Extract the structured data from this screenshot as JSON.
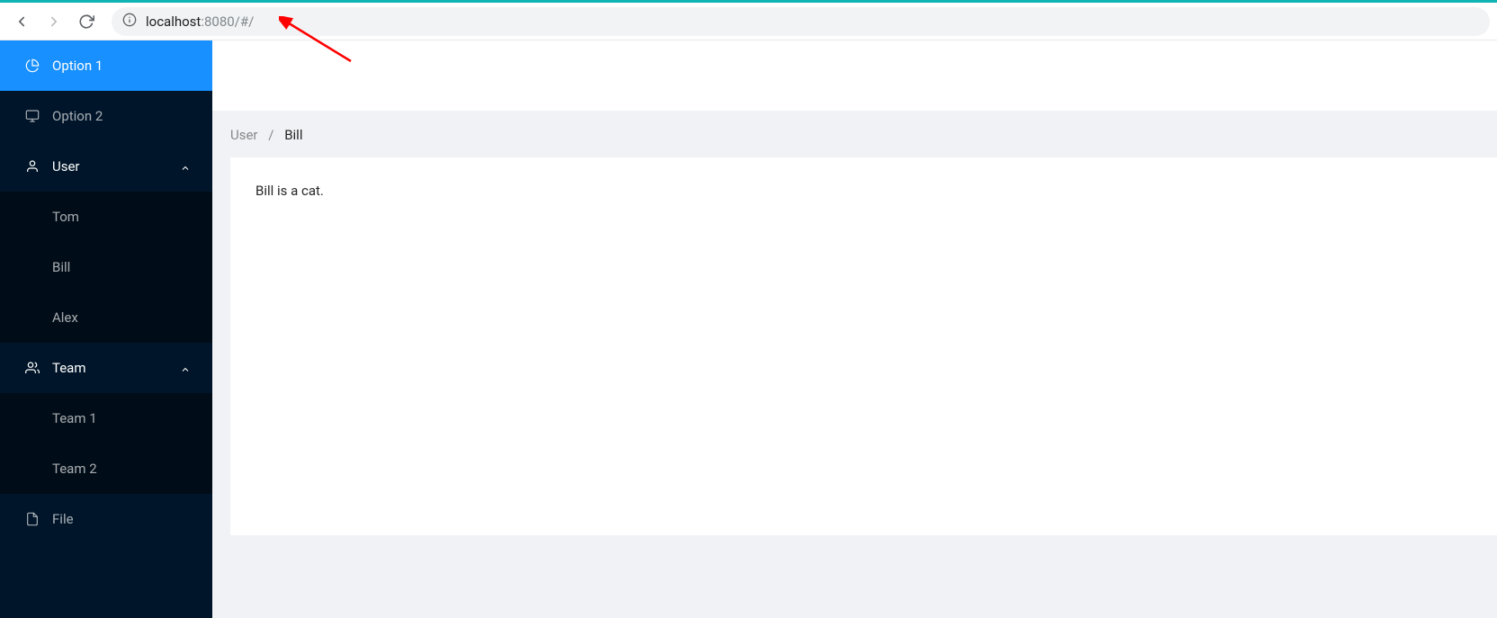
{
  "browser": {
    "url_host": "localhost",
    "url_rest": ":8080/#/"
  },
  "sidebar": {
    "items": [
      {
        "label": "Option 1",
        "icon": "pie-chart",
        "selected": true
      },
      {
        "label": "Option 2",
        "icon": "desktop"
      },
      {
        "label": "User",
        "icon": "user",
        "type": "submenu",
        "children": [
          {
            "label": "Tom"
          },
          {
            "label": "Bill"
          },
          {
            "label": "Alex"
          }
        ]
      },
      {
        "label": "Team",
        "icon": "team",
        "type": "submenu",
        "children": [
          {
            "label": "Team 1"
          },
          {
            "label": "Team 2"
          }
        ]
      },
      {
        "label": "File",
        "icon": "file"
      }
    ]
  },
  "breadcrumb": {
    "items": [
      "User",
      "Bill"
    ],
    "sep": "/"
  },
  "content": {
    "text": "Bill is a cat."
  }
}
